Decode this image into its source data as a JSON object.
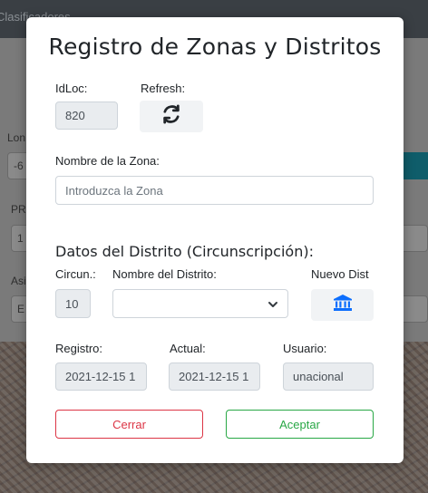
{
  "background": {
    "topbar_text": "Clasificadores",
    "labels": [
      "Lon",
      "PRO",
      "Asi"
    ],
    "values": [
      "-6",
      "1",
      "E"
    ]
  },
  "modal": {
    "title": "Registro de Zonas y Distritos",
    "idloc": {
      "label": "IdLoc:",
      "value": "820"
    },
    "refresh": {
      "label": "Refresh:",
      "icon": "sync-icon"
    },
    "zona": {
      "label": "Nombre de la Zona:",
      "placeholder": "Introduzca la Zona",
      "value": ""
    },
    "distrito_section": {
      "title": "Datos del Distrito (Circunscripción):",
      "circun": {
        "label": "Circun.:",
        "value": "10"
      },
      "nombre_distrito": {
        "label": "Nombre del Distrito:",
        "selected": ""
      },
      "nuevo_dist": {
        "label": "Nuevo Dist",
        "icon": "bank-icon"
      }
    },
    "registro": {
      "label": "Registro:",
      "value": "2021-12-15 1"
    },
    "actual": {
      "label": "Actual:",
      "value": "2021-12-15 1"
    },
    "usuario": {
      "label": "Usuario:",
      "value": "unacional"
    },
    "buttons": {
      "cerrar": "Cerrar",
      "aceptar": "Aceptar"
    }
  },
  "colors": {
    "accent_blue": "#0d6efd",
    "danger": "#dc3545",
    "success": "#28a745"
  }
}
